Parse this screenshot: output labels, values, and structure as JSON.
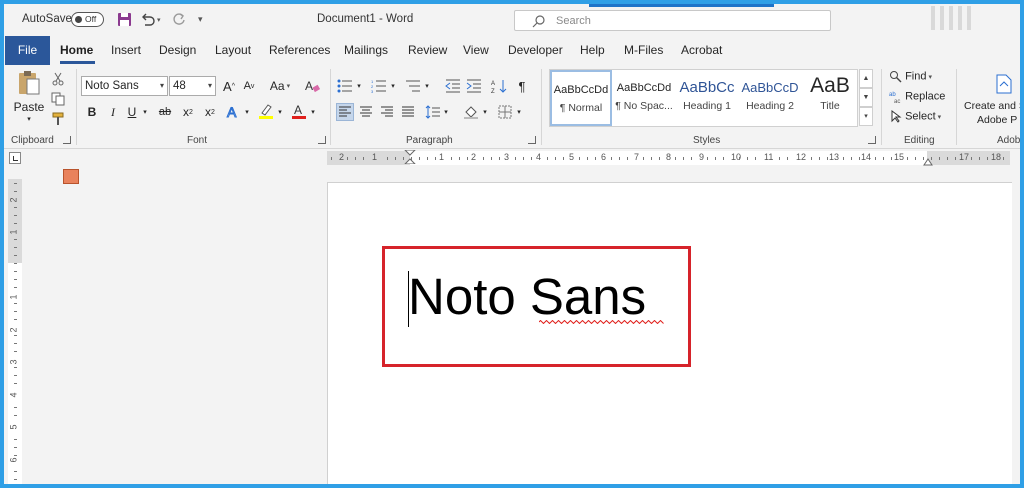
{
  "titlebar": {
    "autosave_label": "AutoSave",
    "autosave_state": "Off",
    "document_title": "Document1  -  Word",
    "search_placeholder": "Search"
  },
  "tabs": {
    "file": "File",
    "home": "Home",
    "insert": "Insert",
    "design": "Design",
    "layout": "Layout",
    "references": "References",
    "mailings": "Mailings",
    "review": "Review",
    "view": "View",
    "developer": "Developer",
    "help": "Help",
    "mfiles": "M-Files",
    "acrobat": "Acrobat",
    "active": "Home"
  },
  "clipboard": {
    "paste_label": "Paste",
    "group_label": "Clipboard"
  },
  "font": {
    "font_name": "Noto Sans",
    "font_size": "48",
    "group_label": "Font",
    "bold": "B",
    "italic": "I",
    "underline": "U",
    "strikethrough": "ab",
    "subscript": "x",
    "superscript": "x",
    "grow": "A",
    "shrink": "A",
    "change_case": "Aa",
    "highlight_color": "#ffff00",
    "font_color": "#e0201c"
  },
  "paragraph": {
    "group_label": "Paragraph"
  },
  "styles": {
    "group_label": "Styles",
    "items": [
      {
        "preview": "AaBbCcDd",
        "name": "¶ Normal"
      },
      {
        "preview": "AaBbCcDd",
        "name": "¶ No Spac..."
      },
      {
        "preview": "AaBbCc",
        "name": "Heading 1"
      },
      {
        "preview": "AaBbCcD",
        "name": "Heading 2"
      },
      {
        "preview": "AaB",
        "name": "Title"
      }
    ]
  },
  "editing": {
    "group_label": "Editing",
    "find": "Find",
    "replace": "Replace",
    "select": "Select"
  },
  "acrobat_group": {
    "label": "Create and S",
    "label2": "Adobe P",
    "group_label": "Adob"
  },
  "ruler": {
    "top_numbers": [
      "2",
      "1",
      "1",
      "2",
      "3",
      "4",
      "5",
      "6",
      "7",
      "8",
      "9",
      "10",
      "11",
      "12",
      "13",
      "14",
      "15",
      "17",
      "18"
    ],
    "left_numbers": [
      "2",
      "1",
      "1",
      "2",
      "3",
      "4",
      "5",
      "6"
    ]
  },
  "document": {
    "text": "Noto Sans"
  },
  "colors": {
    "brand": "#2b579a",
    "frame": "#2f9fe6",
    "highlight_box": "#d6232a"
  }
}
